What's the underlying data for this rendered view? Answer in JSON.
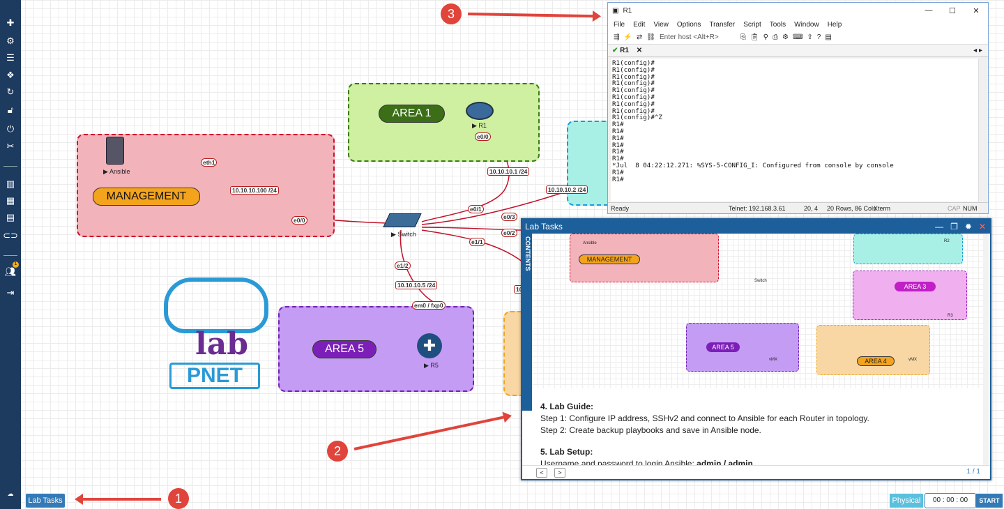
{
  "sidebar": {
    "icons": [
      "plus-icon",
      "cogs-icon",
      "list-icon",
      "cubes-icon",
      "refresh-icon",
      "unlock-icon",
      "power-icon",
      "tools-icon",
      "chart-icon",
      "map-icon",
      "book-icon",
      "toggle-icon",
      "user-plus-icon",
      "logout-icon"
    ],
    "badge": "1"
  },
  "topology": {
    "areas": {
      "area1": "AREA 1",
      "area5": "AREA 5",
      "management": "MANAGEMENT"
    },
    "nodes": {
      "ansible": "Ansible",
      "r1": "R1",
      "switch": "Switch",
      "r5": "R5"
    },
    "links": {
      "eth1": "eth1",
      "ansible_ip": "10.10.10.100 /24",
      "sw_e00": "e0/0",
      "r1_e00": "e0/0",
      "r1_ip": "10.10.10.1 /24",
      "sw_e01": "e0/1",
      "sw_e03": "e0/3",
      "r2_ip": "10.10.10.2 /24",
      "sw_e02": "e0/2",
      "sw_e11": "e1/1",
      "sw_e12": "e1/2",
      "r5_ip": "10.10.10.5 /24",
      "r5_if": "em0 / fxp0",
      "cut_ip": "10"
    },
    "logo": {
      "word1": "lab",
      "word2": "PNET"
    }
  },
  "annotations": {
    "badge1": "1",
    "badge2": "2",
    "badge3": "3"
  },
  "r1_window": {
    "title": "R1",
    "menu": [
      "File",
      "Edit",
      "View",
      "Options",
      "Transfer",
      "Script",
      "Tools",
      "Window",
      "Help"
    ],
    "host_placeholder": "Enter host <Alt+R>",
    "tab": "R1",
    "terminal": "R1(config)#\nR1(config)#\nR1(config)#\nR1(config)#\nR1(config)#\nR1(config)#\nR1(config)#\nR1(config)#\nR1(config)#^Z\nR1#\nR1#\nR1#\nR1#\nR1#\nR1#\n*Jul  8 04:22:12.271: %SYS-5-CONFIG_I: Configured from console by console\nR1#\nR1#",
    "status": {
      "ready": "Ready",
      "telnet": "Telnet: 192.168.3.61",
      "pos": "20,  4",
      "size": "20 Rows, 86 Cols",
      "term": "Xterm",
      "cap": "CAP",
      "num": "NUM"
    }
  },
  "lab_tasks_window": {
    "title": "Lab Tasks",
    "contents_tab": "CONTENTS",
    "mini": {
      "management": "MANAGEMENT",
      "area3": "AREA 3",
      "area5": "AREA 5",
      "area4": "AREA 4",
      "ansible": "Ansible",
      "switch": "Switch",
      "r2": "R2",
      "r3": "R3",
      "vmx1": "vMX",
      "vmx2": "vMX"
    },
    "guide_heading": "4. Lab Guide:",
    "step1": "Step 1: Configure IP address, SSHv2 and connect to Ansible for each Router in topology.",
    "step2": "Step 2: Create backup playbooks and save in Ansible node.",
    "setup_heading": "5. Lab Setup:",
    "setup_text": "Username and password to login Ansible: ",
    "setup_cred": "admin / admin",
    "setup_end": ".",
    "page": "1 / 1"
  },
  "bottom": {
    "lab_tasks": "Lab Tasks",
    "physical": "Physical",
    "timer": "00 : 00 : 00",
    "start": "START"
  }
}
